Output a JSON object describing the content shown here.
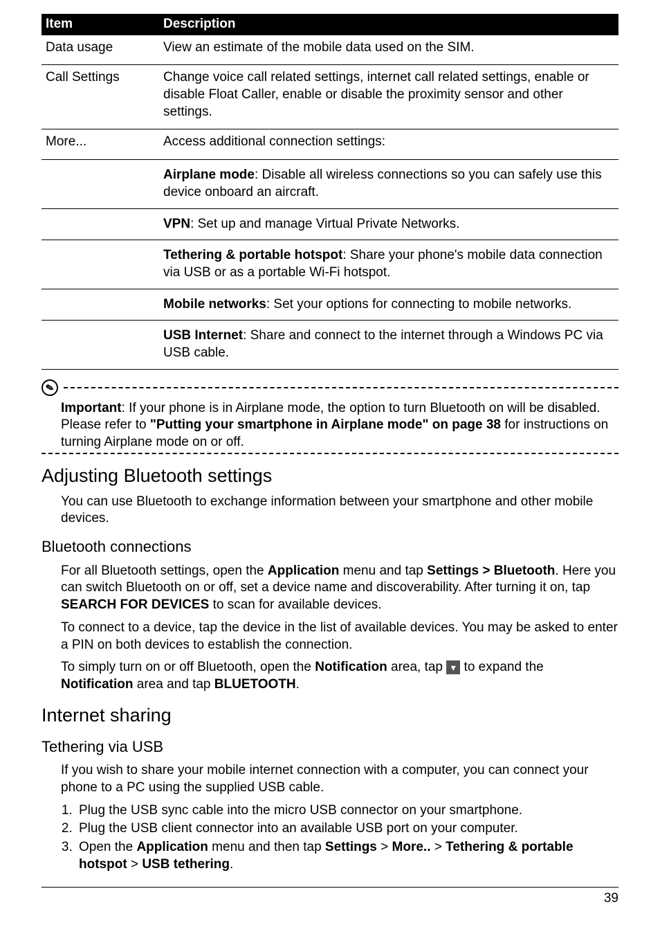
{
  "table": {
    "headers": {
      "item": "Item",
      "desc": "Description"
    },
    "rows": [
      {
        "item": "Data usage",
        "desc": "View an estimate of the mobile data used on the SIM."
      },
      {
        "item": "Call Settings",
        "desc": "Change voice call related settings, internet call related settings, enable or disable Float Caller, enable or disable the proximity sensor and other settings."
      },
      {
        "item": "More...",
        "desc": "Access additional connection settings:"
      }
    ],
    "more_items": [
      {
        "bold": "Airplane mode",
        "rest": ": Disable all wireless connections so you can safely use this device onboard an aircraft."
      },
      {
        "bold": "VPN",
        "rest": ": Set up and manage Virtual Private Networks."
      },
      {
        "bold": "Tethering & portable hotspot",
        "rest": ": Share your phone's mobile data connection via USB or as a portable Wi-Fi hotspot."
      },
      {
        "bold": "Mobile networks",
        "rest": ": Set your options for connecting to mobile networks."
      },
      {
        "bold": "USB Internet",
        "rest": ": Share and connect to the internet through a Windows PC via USB cable."
      }
    ]
  },
  "note": {
    "bold1": "Important",
    "text1": ": If your phone is in Airplane mode, the option to turn Bluetooth on will be disabled. Please refer to ",
    "bold2": "\"Putting your smartphone in Airplane mode\" on page 38",
    "text2": " for instructions on turning Airplane mode on or off."
  },
  "bluetooth": {
    "heading": "Adjusting Bluetooth settings",
    "intro": "You can use Bluetooth to exchange information between your smartphone and other mobile devices.",
    "sub": "Bluetooth connections",
    "p1": {
      "t1": "For all Bluetooth settings, open the ",
      "b1": "Application",
      "t2": " menu and tap ",
      "b2": "Settings > Bluetooth",
      "t3": ". Here you can switch Bluetooth on or off, set a device name and discoverability. After turning it on, tap ",
      "b3": "SEARCH FOR DEVICES",
      "t4": " to scan for available devices."
    },
    "p2": "To connect to a device, tap the device in the list of available devices. You may be asked to enter a PIN on both devices to establish the connection.",
    "p3": {
      "t1": "To simply turn on or off Bluetooth, open the ",
      "b1": "Notification",
      "t2": " area, tap ",
      "t3": " to expand the ",
      "b2": "Notification",
      "t4": " area and tap ",
      "b3": "BLUETOOTH",
      "t5": "."
    }
  },
  "internet": {
    "heading": "Internet sharing",
    "sub": "Tethering via USB",
    "intro": "If you wish to share your mobile internet connection with a computer, you can connect your phone to a PC using the supplied USB cable.",
    "steps": {
      "s1": "Plug the USB sync cable into the micro USB connector on your smartphone.",
      "s2": "Plug the USB client connector into an available USB port on your computer.",
      "s3": {
        "t1": "Open the ",
        "b1": "Application",
        "t2": " menu and then tap ",
        "b2": "Settings",
        "t3": " > ",
        "b3": "More..",
        "t4": " > ",
        "b4": "Tethering & portable hotspot",
        "t5": " > ",
        "b5": "USB tethering",
        "t6": "."
      }
    }
  },
  "page_number": "39"
}
